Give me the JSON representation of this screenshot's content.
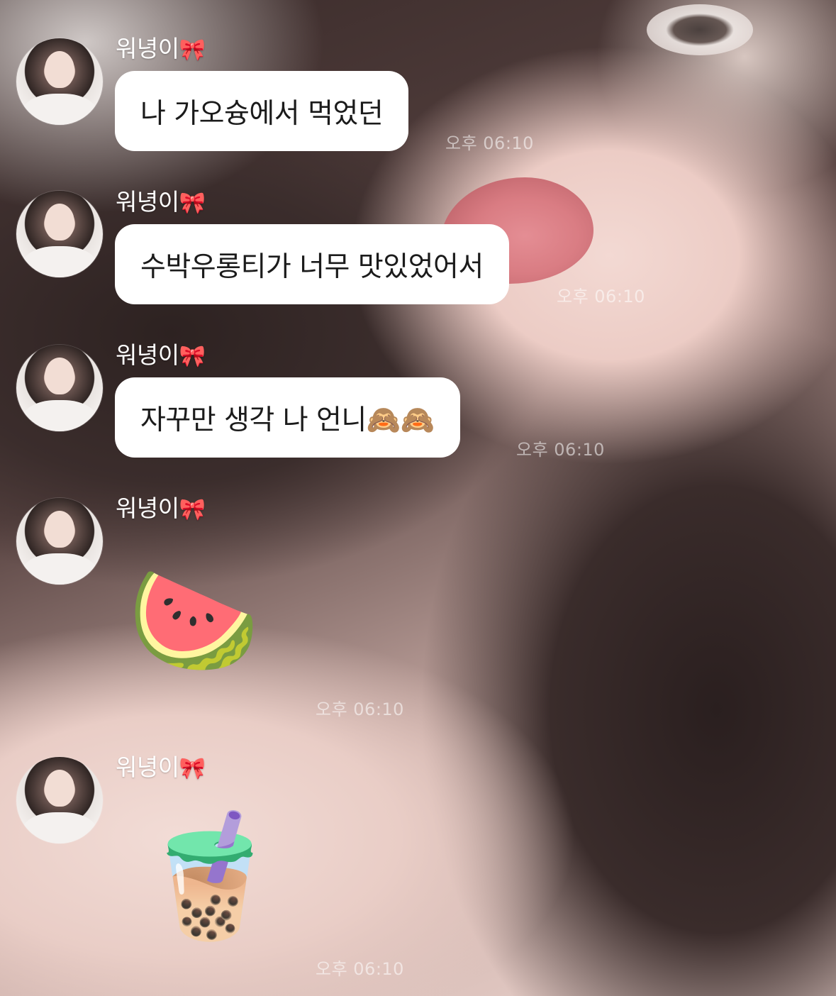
{
  "messages": [
    {
      "sender": "워녕이",
      "sender_icon": "🎀",
      "text": "나 가오슝에서 먹었던",
      "time": "오후 06:10"
    },
    {
      "sender": "워녕이",
      "sender_icon": "🎀",
      "text": "수박우롱티가 너무 맛있었어서",
      "time": "오후 06:10"
    },
    {
      "sender": "워녕이",
      "sender_icon": "🎀",
      "text": "자꾸만 생각 나 언니🙈🙈",
      "time": "오후 06:10"
    },
    {
      "sender": "워녕이",
      "sender_icon": "🎀",
      "emoji": "🍉",
      "time": "오후 06:10"
    },
    {
      "sender": "워녕이",
      "sender_icon": "🎀",
      "emoji": "🧋",
      "time": "오후 06:10"
    }
  ]
}
